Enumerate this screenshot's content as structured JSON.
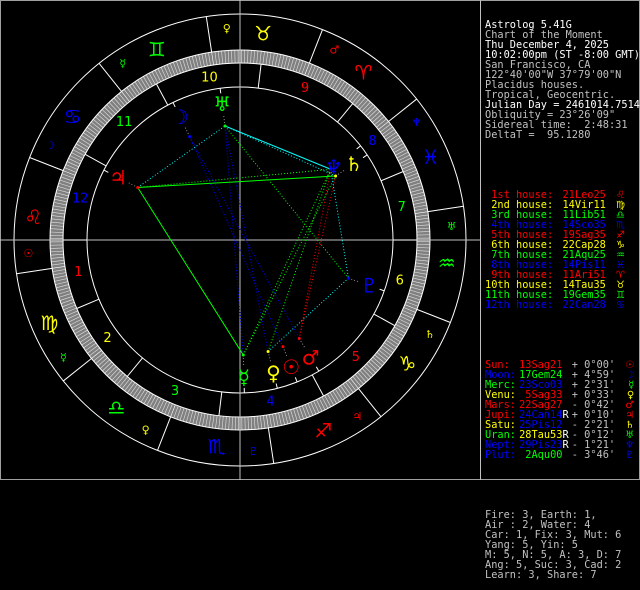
{
  "header": [
    {
      "text": "Astrolog 5.41G",
      "color": "#ffffff"
    },
    {
      "text": "Chart of the Moment",
      "color": "#c0c0c0"
    },
    {
      "text": "Thu December 4, 2025",
      "color": "#ffffff"
    },
    {
      "text": "10:02:00pm (ST -8:00 GMT)",
      "color": "#ffffff"
    },
    {
      "text": "San Francisco, CA",
      "color": "#c0c0c0"
    },
    {
      "text": "122°40'00\"W 37°79'00\"N",
      "color": "#c0c0c0"
    },
    {
      "text": "Placidus houses.",
      "color": "#c0c0c0"
    },
    {
      "text": "Tropical, Geocentric.",
      "color": "#c0c0c0"
    },
    {
      "text": "Julian Day = 2461014.7514",
      "color": "#ffffff"
    },
    {
      "text": "Obliquity = 23°26'09\"",
      "color": "#c0c0c0"
    },
    {
      "text": "Sidereal time:  2:48:31",
      "color": "#c0c0c0"
    },
    {
      "text": "DeltaT =  95.1280",
      "color": "#c0c0c0"
    }
  ],
  "houses": [
    {
      "label": "1st house:",
      "value": "21Leo25",
      "glyph": "♌",
      "icon": "leo-icon",
      "color": "#ff0000",
      "valueColor": "#ff0000"
    },
    {
      "label": "2nd house:",
      "value": "14Vir11",
      "glyph": "♍",
      "icon": "virgo-icon",
      "color": "#ffff00",
      "valueColor": "#ffff00"
    },
    {
      "label": "3rd house:",
      "value": "11Lib51",
      "glyph": "♎",
      "icon": "libra-icon",
      "color": "#00ff00",
      "valueColor": "#00ff00"
    },
    {
      "label": "4th house:",
      "value": "14Sco35",
      "glyph": "♏",
      "icon": "scorpio-icon",
      "color": "#0000ff",
      "valueColor": "#0000ff"
    },
    {
      "label": "5th house:",
      "value": "19Sag35",
      "glyph": "♐",
      "icon": "sagittarius-icon",
      "color": "#ff0000",
      "valueColor": "#ff0000"
    },
    {
      "label": "6th house:",
      "value": "22Cap28",
      "glyph": "♑",
      "icon": "capricorn-icon",
      "color": "#ffff00",
      "valueColor": "#ffff00"
    },
    {
      "label": "7th house:",
      "value": "21Aqu25",
      "glyph": "♒",
      "icon": "aquarius-icon",
      "color": "#00ff00",
      "valueColor": "#00ff00"
    },
    {
      "label": "8th house:",
      "value": "14Pis11",
      "glyph": "♓",
      "icon": "pisces-icon",
      "color": "#0000ff",
      "valueColor": "#0000ff"
    },
    {
      "label": "9th house:",
      "value": "11Ari51",
      "glyph": "♈",
      "icon": "aries-icon",
      "color": "#ff0000",
      "valueColor": "#ff0000"
    },
    {
      "label": "10th house:",
      "value": "14Tau35",
      "glyph": "♉",
      "icon": "taurus-icon",
      "color": "#ffff00",
      "valueColor": "#ffff00"
    },
    {
      "label": "11th house:",
      "value": "19Gem35",
      "glyph": "♊",
      "icon": "gemini-icon",
      "color": "#00ff00",
      "valueColor": "#00ff00"
    },
    {
      "label": "12th house:",
      "value": "22Can28",
      "glyph": "♋",
      "icon": "cancer-icon",
      "color": "#0000ff",
      "valueColor": "#0000ff"
    }
  ],
  "planets": [
    {
      "name": "Sun:",
      "position": "13Sag21",
      "retro": "",
      "speed": "+ 0°00'",
      "glyph": "☉",
      "icon": "sun-icon",
      "color": "#ff0000",
      "posColor": "#ff0000"
    },
    {
      "name": "Moon:",
      "position": "17Gem24",
      "retro": "",
      "speed": "+ 4°59'",
      "glyph": "☽",
      "icon": "moon-icon",
      "color": "#0000ff",
      "posColor": "#00ff00"
    },
    {
      "name": "Merc:",
      "position": "23Sco03",
      "retro": "",
      "speed": "+ 2°31'",
      "glyph": "☿",
      "icon": "mercury-icon",
      "color": "#00ff00",
      "posColor": "#0000ff"
    },
    {
      "name": "Venu:",
      "position": "5Sag33",
      "retro": "",
      "speed": "+ 0°33'",
      "glyph": "♀",
      "icon": "venus-icon",
      "color": "#ffff00",
      "posColor": "#ff0000"
    },
    {
      "name": "Mars:",
      "position": "22Sag27",
      "retro": "",
      "speed": "- 0°42'",
      "glyph": "♂",
      "icon": "mars-icon",
      "color": "#ff0000",
      "posColor": "#ff0000"
    },
    {
      "name": "Jupi:",
      "position": "24Can14",
      "retro": "R",
      "speed": "+ 0°10'",
      "glyph": "♃",
      "icon": "jupiter-icon",
      "color": "#ff0000",
      "posColor": "#0000ff"
    },
    {
      "name": "Satu:",
      "position": "25Pis12",
      "retro": "",
      "speed": "- 2°21'",
      "glyph": "♄",
      "icon": "saturn-icon",
      "color": "#ffff00",
      "posColor": "#0000ff"
    },
    {
      "name": "Uran:",
      "position": "28Tau53",
      "retro": "R",
      "speed": "- 0°12'",
      "glyph": "♅",
      "icon": "uranus-icon",
      "color": "#00ff00",
      "posColor": "#ffff00"
    },
    {
      "name": "Nept:",
      "position": "29Pis23",
      "retro": "R",
      "speed": "- 1°21'",
      "glyph": "♆",
      "icon": "neptune-icon",
      "color": "#0000ff",
      "posColor": "#0000ff"
    },
    {
      "name": "Plut:",
      "position": "2Aqu00",
      "retro": "",
      "speed": "- 3°46'",
      "glyph": "♇",
      "icon": "pluto-icon",
      "color": "#0000ff",
      "posColor": "#00ff00"
    }
  ],
  "stats": [
    "Fire: 3, Earth: 1,",
    "Air : 2, Water: 4",
    "Car: 1, Fix: 3, Mut: 6",
    "Yang: 5, Yin: 5",
    "M: 5, N: 5, A: 3, D: 7",
    "Ang: 5, Suc: 3, Cad: 2",
    "Learn: 3, Share: 7"
  ],
  "signs": [
    {
      "abbr": "Ari",
      "glyph": "♈",
      "icon": "aries-icon",
      "color": "#ff0000",
      "ruler": "♂",
      "rulerColor": "#ff0000"
    },
    {
      "abbr": "Tau",
      "glyph": "♉",
      "icon": "taurus-icon",
      "color": "#ffff00",
      "ruler": "♀",
      "rulerColor": "#ffff00"
    },
    {
      "abbr": "Gem",
      "glyph": "♊",
      "icon": "gemini-icon",
      "color": "#00ff00",
      "ruler": "☿",
      "rulerColor": "#00ff00"
    },
    {
      "abbr": "Can",
      "glyph": "♋",
      "icon": "cancer-icon",
      "color": "#0000ff",
      "ruler": "☽",
      "rulerColor": "#0000ff"
    },
    {
      "abbr": "Leo",
      "glyph": "♌",
      "icon": "leo-icon",
      "color": "#ff0000",
      "ruler": "☉",
      "rulerColor": "#ff0000"
    },
    {
      "abbr": "Vir",
      "glyph": "♍",
      "icon": "virgo-icon",
      "color": "#ffff00",
      "ruler": "☿",
      "rulerColor": "#00ff00"
    },
    {
      "abbr": "Lib",
      "glyph": "♎",
      "icon": "libra-icon",
      "color": "#00ff00",
      "ruler": "♀",
      "rulerColor": "#ffff00"
    },
    {
      "abbr": "Sco",
      "glyph": "♏",
      "icon": "scorpio-icon",
      "color": "#0000ff",
      "ruler": "♇",
      "rulerColor": "#0000ff"
    },
    {
      "abbr": "Sag",
      "glyph": "♐",
      "icon": "sagittarius-icon",
      "color": "#ff0000",
      "ruler": "♃",
      "rulerColor": "#ff0000"
    },
    {
      "abbr": "Cap",
      "glyph": "♑",
      "icon": "capricorn-icon",
      "color": "#ffff00",
      "ruler": "♄",
      "rulerColor": "#ffff00"
    },
    {
      "abbr": "Aqu",
      "glyph": "♒",
      "icon": "aquarius-icon",
      "color": "#00ff00",
      "ruler": "♅",
      "rulerColor": "#00ff00"
    },
    {
      "abbr": "Pis",
      "glyph": "♓",
      "icon": "pisces-icon",
      "color": "#0000ff",
      "ruler": "♆",
      "rulerColor": "#0000ff"
    }
  ],
  "house_numbers": [
    "1",
    "2",
    "3",
    "4",
    "5",
    "6",
    "7",
    "8",
    "9",
    "10",
    "11",
    "12"
  ],
  "aspect_colors": {
    "0": "#ffff00",
    "60": "#00ffff",
    "90": "#ff0000",
    "120": "#00ff00",
    "180": "#0000ff"
  }
}
